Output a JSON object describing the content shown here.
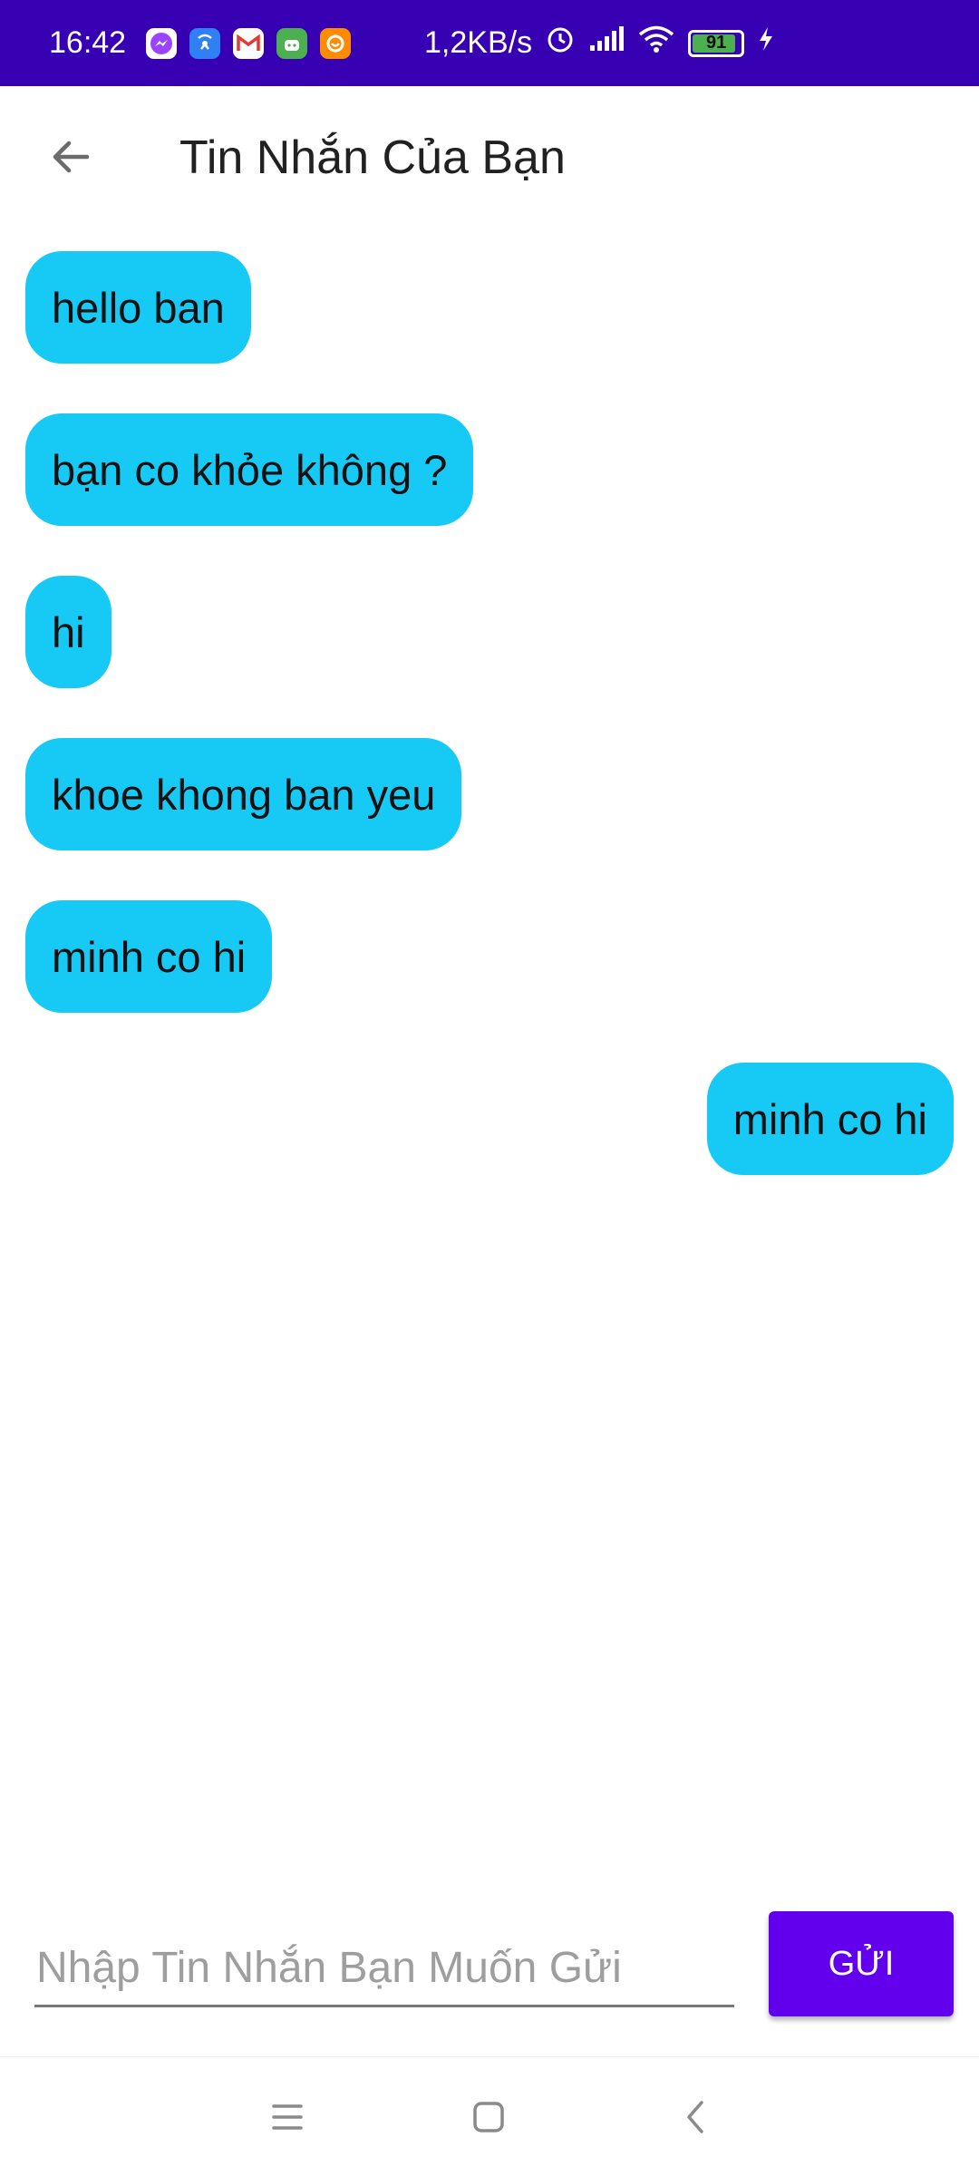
{
  "status_bar": {
    "time": "16:42",
    "apps": [
      {
        "icon": "messenger-icon",
        "glyph": "m",
        "color": "#9b44ff"
      },
      {
        "icon": "wifi-calling-icon",
        "glyph": "w",
        "color": "#2f7ff5"
      },
      {
        "icon": "gmail-icon",
        "glyph": "M",
        "color": "#ffffff"
      },
      {
        "icon": "android-bot-icon",
        "glyph": "a",
        "color": "#4caf50"
      },
      {
        "icon": "orange-app-icon",
        "glyph": "u",
        "color": "#ff8c00"
      }
    ],
    "net_speed": "1,2KB/s",
    "battery_level": "91",
    "battery_fraction": 0.91
  },
  "app_bar": {
    "title": "Tin Nhắn Của Bạn",
    "back_icon": "arrow-left-icon"
  },
  "messages": [
    {
      "text": "hello ban",
      "side": "left"
    },
    {
      "text": "bạn co khỏe không ?",
      "side": "left"
    },
    {
      "text": "hi",
      "side": "left"
    },
    {
      "text": "khoe khong ban yeu",
      "side": "left"
    },
    {
      "text": "minh co hi",
      "side": "left"
    },
    {
      "text": "minh co hi",
      "side": "right"
    }
  ],
  "composer": {
    "placeholder": "Nhập Tin Nhắn Bạn Muốn Gửi",
    "value": "",
    "send_label": "GỬI"
  },
  "nav_bar": {
    "recents_icon": "menu-lines-icon",
    "home_icon": "square-home-icon",
    "back_icon": "chevron-left-icon"
  },
  "colors": {
    "status_bar": "#3700b3",
    "bubble": "#17c9f5",
    "send_button": "#6200ee"
  }
}
